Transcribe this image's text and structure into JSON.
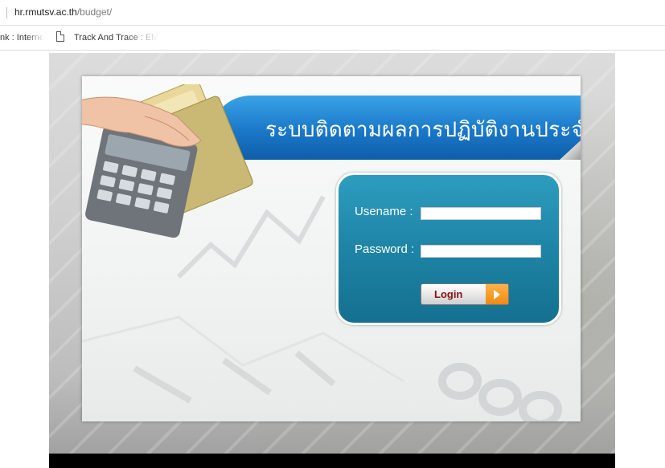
{
  "browser": {
    "url_host": "hr.rmutsv.ac.th",
    "url_path": "/budget/",
    "bookmarks": [
      {
        "label": "nk : Interne"
      },
      {
        "label": "Track And Trace : EM"
      }
    ]
  },
  "page": {
    "title": "ระบบติดตามผลการปฏิบัติงานประจำปี",
    "login": {
      "username_label": "Usename :",
      "password_label": "Password :",
      "username_value": "",
      "password_value": "",
      "button_label": "Login"
    }
  },
  "colors": {
    "banner": "#1a78c9",
    "login_panel": "#1e84a6",
    "login_arrow": "#f08a12"
  }
}
